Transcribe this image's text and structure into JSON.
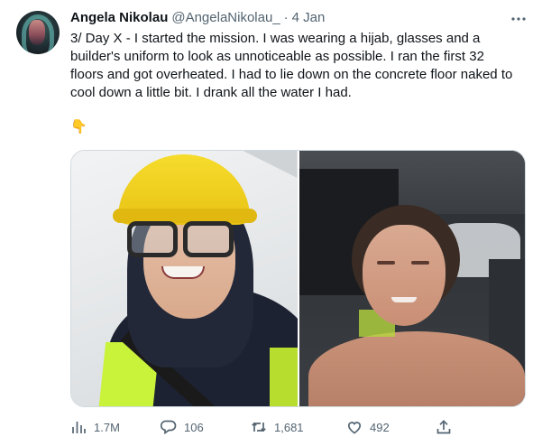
{
  "author": {
    "name": "Angela Nikolau",
    "handle": "@AngelaNikolau_",
    "separator": "·",
    "date": "4 Jan"
  },
  "tweet": {
    "lines": [
      "3/ Day X - I started the mission. I was wearing a hijab, glasses and a",
      "builder's uniform to look as unnoticeable as possible. I ran the first 32",
      "floors and got overheated. I had to lie down on the concrete floor naked to",
      "cool down a little bit. I drank all the water I had."
    ],
    "emoji": "👇"
  },
  "media": {
    "photos": [
      {
        "icon": "photo-woman-yellow-helmet"
      },
      {
        "icon": "photo-woman-lying-on-floor"
      }
    ]
  },
  "actions": {
    "views": "1.7M",
    "replies": "106",
    "retweets": "1,681",
    "likes": "492"
  },
  "colors": {
    "text": "#0f1419",
    "secondary": "#536471",
    "border": "#cfd9de"
  }
}
